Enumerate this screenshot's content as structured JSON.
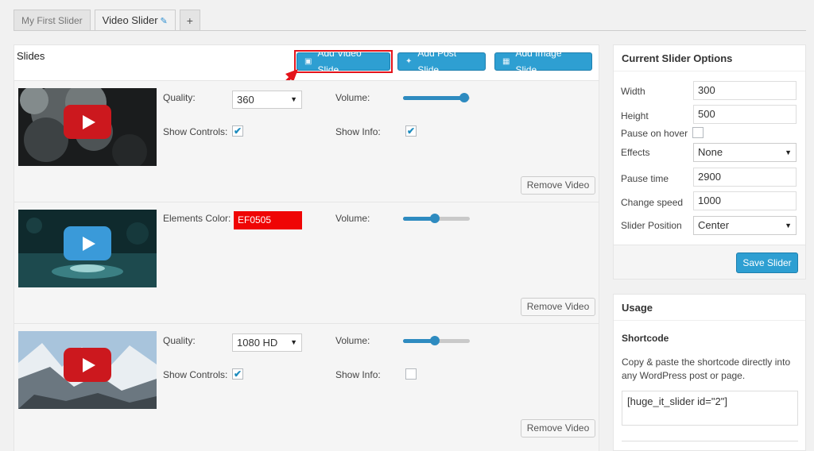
{
  "tabs": [
    {
      "label": "My First Slider"
    },
    {
      "label": "Video Slider"
    },
    {
      "label": "+"
    }
  ],
  "slides_panel": {
    "title": "Slides",
    "buttons": {
      "add_video": "Add Video Slide",
      "add_post": "Add Post Slide",
      "add_image": "Add Image Slide"
    }
  },
  "slides": [
    {
      "quality_label": "Quality:",
      "quality_value": "360",
      "volume_label": "Volume:",
      "volume_level": 0.92,
      "show_controls_label": "Show Controls:",
      "show_controls_checked": true,
      "show_info_label": "Show Info:",
      "show_info_checked": true,
      "remove_label": "Remove Video",
      "play_color": "#cc181e"
    },
    {
      "elements_color_label": "Elements Color:",
      "elements_color_value": "EF0505",
      "volume_label": "Volume:",
      "volume_level": 0.48,
      "remove_label": "Remove Video",
      "play_color": "#3a9ad9"
    },
    {
      "quality_label": "Quality:",
      "quality_value": "1080 HD",
      "volume_label": "Volume:",
      "volume_level": 0.48,
      "show_controls_label": "Show Controls:",
      "show_controls_checked": true,
      "show_info_label": "Show Info:",
      "show_info_checked": false,
      "remove_label": "Remove Video",
      "play_color": "#cc181e"
    }
  ],
  "options": {
    "title": "Current Slider Options",
    "width_label": "Width",
    "width_value": "300",
    "height_label": "Height",
    "height_value": "500",
    "pause_hover_label": "Pause on hover",
    "effects_label": "Effects",
    "effects_value": "None",
    "pause_time_label": "Pause time",
    "pause_time_value": "2900",
    "change_speed_label": "Change speed",
    "change_speed_value": "1000",
    "position_label": "Slider Position",
    "position_value": "Center",
    "save_label": "Save Slider"
  },
  "usage": {
    "title": "Usage",
    "shortcode_title": "Shortcode",
    "description": "Copy & paste the shortcode directly into any WordPress post or page.",
    "shortcode": "[huge_it_slider id=\"2\"]"
  },
  "colors": {
    "accent": "#2e9fd2",
    "highlight": "#e4141b",
    "elements_color": "#EF0505"
  }
}
